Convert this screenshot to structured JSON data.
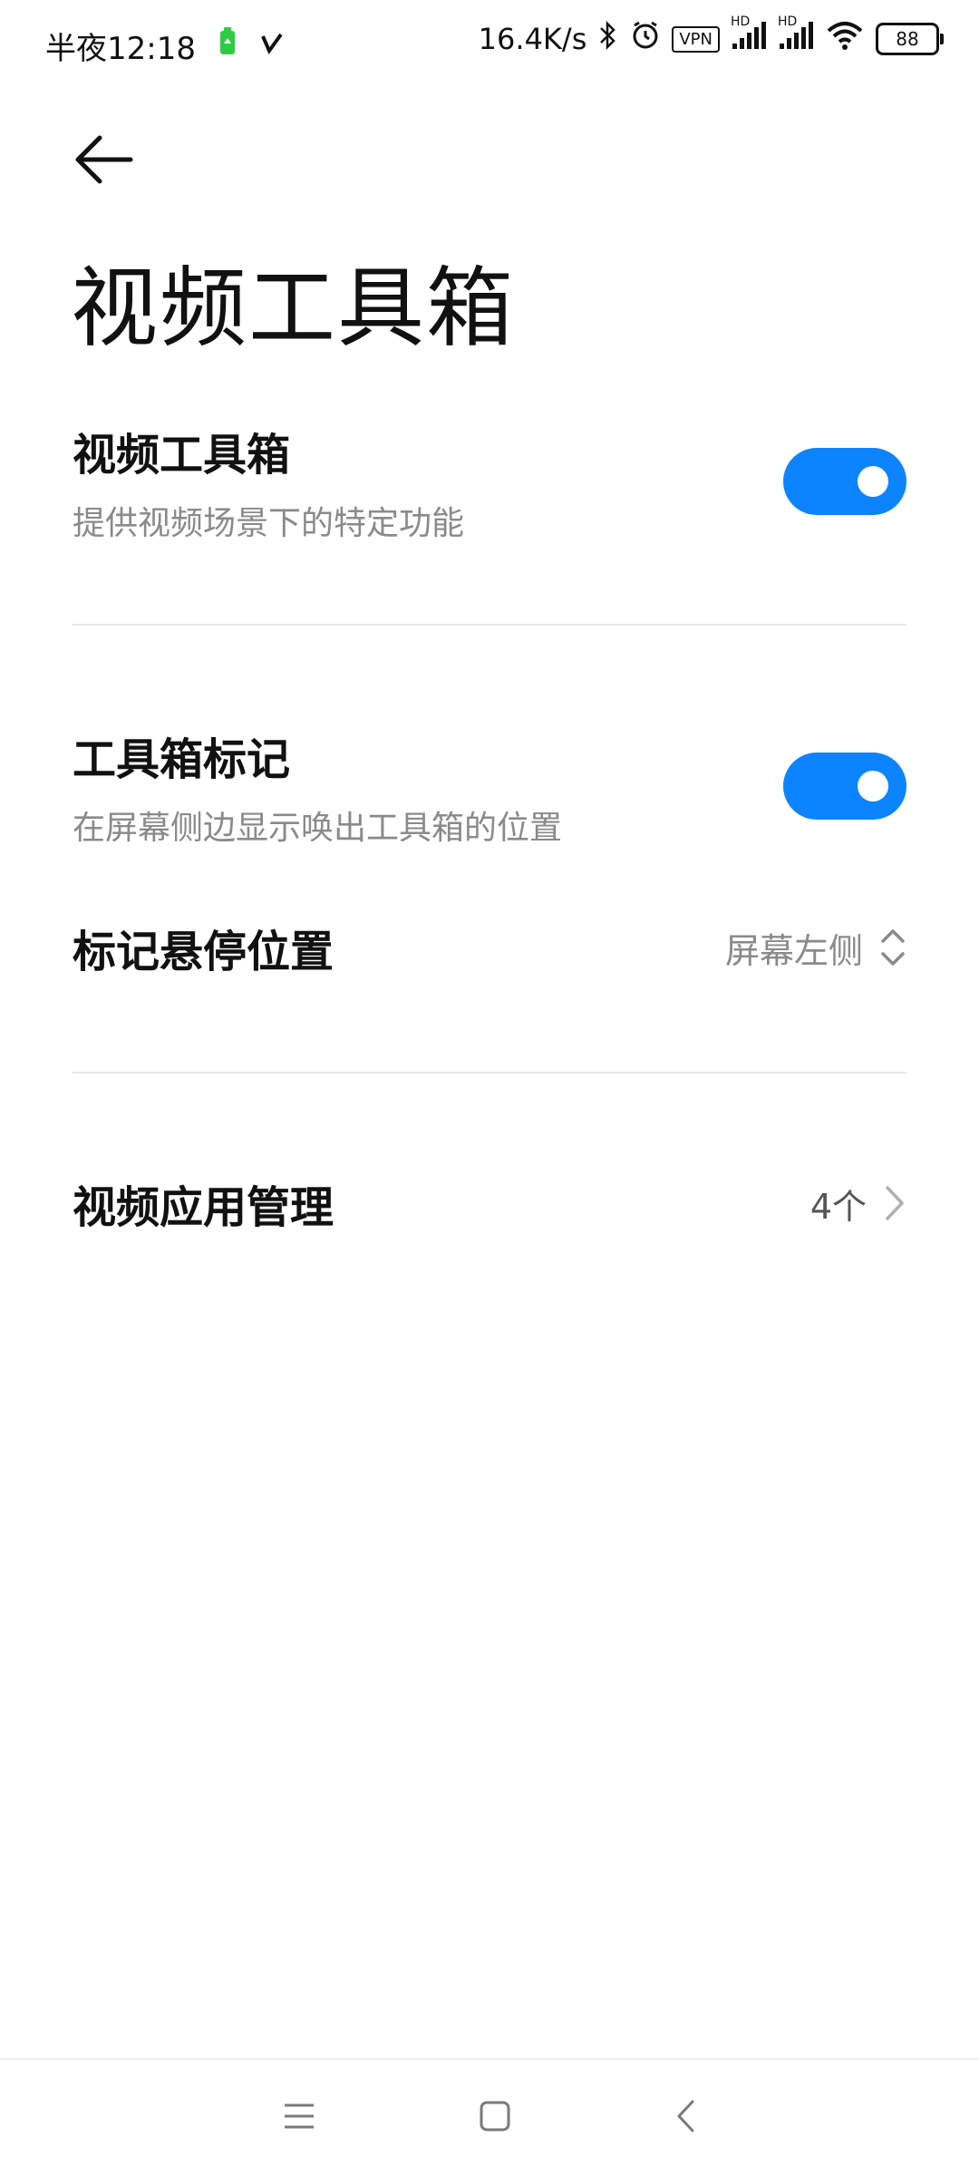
{
  "status_bar": {
    "time": "半夜12:18",
    "speed": "16.4K/s",
    "vpn": "VPN",
    "hd1": "HD",
    "hd2": "HD",
    "battery": "88"
  },
  "header": {
    "title": "视频工具箱"
  },
  "settings": {
    "video_toolbox": {
      "title": "视频工具箱",
      "subtitle": "提供视频场景下的特定功能",
      "enabled": true
    },
    "toolbox_marker": {
      "title": "工具箱标记",
      "subtitle": "在屏幕侧边显示唤出工具箱的位置",
      "enabled": true
    },
    "marker_position": {
      "title": "标记悬停位置",
      "value": "屏幕左侧"
    },
    "app_management": {
      "title": "视频应用管理",
      "value": "4个"
    }
  },
  "colors": {
    "accent": "#0d84ff",
    "secondary_text": "#8a8a8a",
    "divider": "#e6e6e6"
  }
}
